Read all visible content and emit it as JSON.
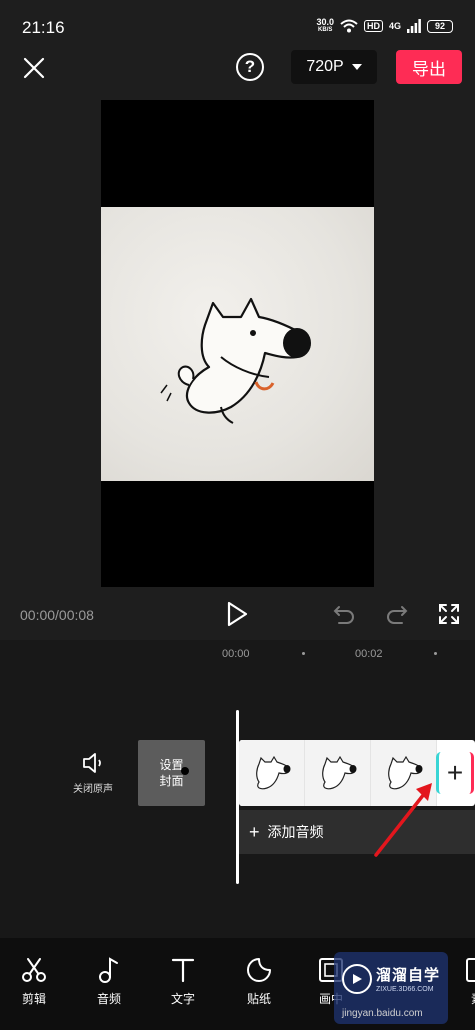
{
  "status_bar": {
    "time": "21:16",
    "net_speed_value": "30.0",
    "net_speed_unit": "KB/S",
    "hd": "HD",
    "network": "4G",
    "battery": "92"
  },
  "top_bar": {
    "help_symbol": "?",
    "resolution": "720P",
    "export_label": "导出"
  },
  "playback": {
    "timecode": "00:00/00:08"
  },
  "timeline": {
    "ruler": [
      "00:00",
      "00:02"
    ]
  },
  "track_controls": {
    "mute_label": "关闭原声",
    "cover_label_line1": "设置",
    "cover_label_line2": "封面",
    "add_clip_symbol": "+"
  },
  "audio_track": {
    "plus": "+",
    "label": "添加音频"
  },
  "toolbar": {
    "items": [
      {
        "label": "剪辑",
        "icon": "scissors-icon"
      },
      {
        "label": "音频",
        "icon": "music-note-icon"
      },
      {
        "label": "文字",
        "icon": "text-icon"
      },
      {
        "label": "贴纸",
        "icon": "sticker-icon"
      },
      {
        "label": "画中",
        "icon": "picture-in-picture-icon"
      },
      {
        "label": "素",
        "icon": "material-icon"
      }
    ]
  },
  "watermark": {
    "title": "溜溜自学",
    "subtitle": "ZIXUE.3D66.COM",
    "url": "jingyan.baidu.com"
  },
  "colors": {
    "accent": "#fe2c55",
    "cyan": "#39d5d5",
    "background": "#1e1e1e"
  }
}
